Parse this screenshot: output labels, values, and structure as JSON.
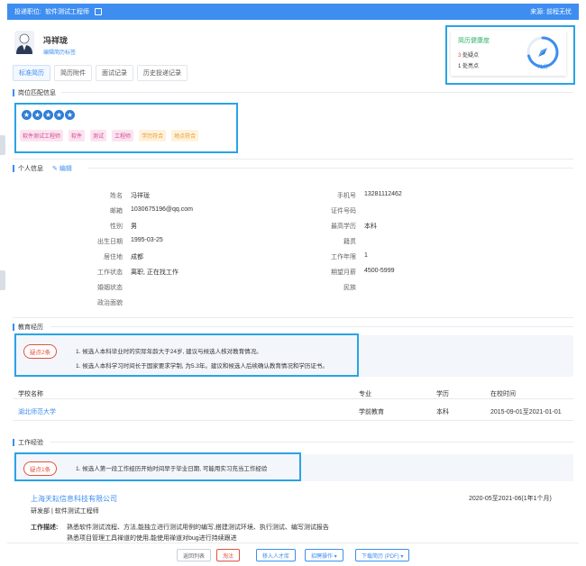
{
  "topbar": {
    "position_label": "投递职位:",
    "position_value": "软件测试工程师",
    "source": "来源: 前程无忧"
  },
  "candidate": {
    "name": "冯祥珑",
    "sub": "编辑简历标签"
  },
  "tabs": [
    "标准简历",
    "简历附件",
    "面试记录",
    "历史投递记录"
  ],
  "health": {
    "title": "简历健康度",
    "doubt": "3",
    "doubt_label": "处疑点",
    "bright": "1",
    "bright_label": "处亮点",
    "score": "71分",
    "score_value": 71
  },
  "match": {
    "title": "岗位匹配信息",
    "stars": 5,
    "tags": [
      {
        "text": "软件测试工程师",
        "color": "pink"
      },
      {
        "text": "软件",
        "color": "pink"
      },
      {
        "text": "测试",
        "color": "pink"
      },
      {
        "text": "工程师",
        "color": "pink"
      },
      {
        "text": "学历符合",
        "color": "orange"
      },
      {
        "text": "地点符合",
        "color": "orange"
      }
    ]
  },
  "personal": {
    "title": "个人信息",
    "edit": "编辑",
    "left": [
      {
        "label": "姓名",
        "value": "冯祥珑"
      },
      {
        "label": "邮箱",
        "value": "1030675196@qq.com"
      },
      {
        "label": "性别",
        "value": "男"
      },
      {
        "label": "出生日期",
        "value": "1995-03-25"
      },
      {
        "label": "居住地",
        "value": "成都"
      },
      {
        "label": "工作状态",
        "value": "离职, 正在找工作"
      },
      {
        "label": "婚姻状态",
        "value": ""
      },
      {
        "label": "政治面貌",
        "value": ""
      }
    ],
    "right": [
      {
        "label": "手机号",
        "value": "13281112462"
      },
      {
        "label": "证件号码",
        "value": ""
      },
      {
        "label": "最高学历",
        "value": "本科"
      },
      {
        "label": "籍贯",
        "value": ""
      },
      {
        "label": "工作年限",
        "value": "1"
      },
      {
        "label": "期望月薪",
        "value": "4500-5999"
      },
      {
        "label": "民族",
        "value": ""
      }
    ]
  },
  "education": {
    "title": "教育经历",
    "doubt_pill": "疑点2条",
    "doubts": [
      "1. 候选人本科毕业时的实际年龄大于24岁, 建议与候选人核对教育情况。",
      "1. 候选人本科学习时间长于国家要求学制, 为5.3年。建议和候选人后续确认教育情况和学历证书。"
    ],
    "headers": [
      "学校名称",
      "专业",
      "学历",
      "在校时间"
    ],
    "rows": [
      {
        "school": "湖北师范大学",
        "major": "学前教育",
        "degree": "本科",
        "time": "2015-09-01至2021-01-01"
      }
    ]
  },
  "work": {
    "title": "工作经验",
    "doubt_pill": "疑点1条",
    "doubts": [
      "1. 候选人第一段工作经历开始时间早于毕业日期, 可能用实习充当工作经验"
    ],
    "company": "上海天耘信息科技有限公司",
    "period": "2020-05至2021-06(1年1个月)",
    "role": "研发部 | 软件测试工程师",
    "desc_label": "工作描述:",
    "desc": [
      "熟悉软件测试流程、方法,能独立进行测试用例的编写,搭建测试环境、执行测试、编写测试报告",
      "熟悉项目管理工具禅道的使用,能使用禅道对bug进行持续跟进"
    ]
  },
  "footer": {
    "back": "返回列表",
    "eliminate": "淘汰",
    "talent": "移入人才库",
    "invite": "招聘操作 ▾",
    "download": "下载简历 (PDF) ▾"
  }
}
